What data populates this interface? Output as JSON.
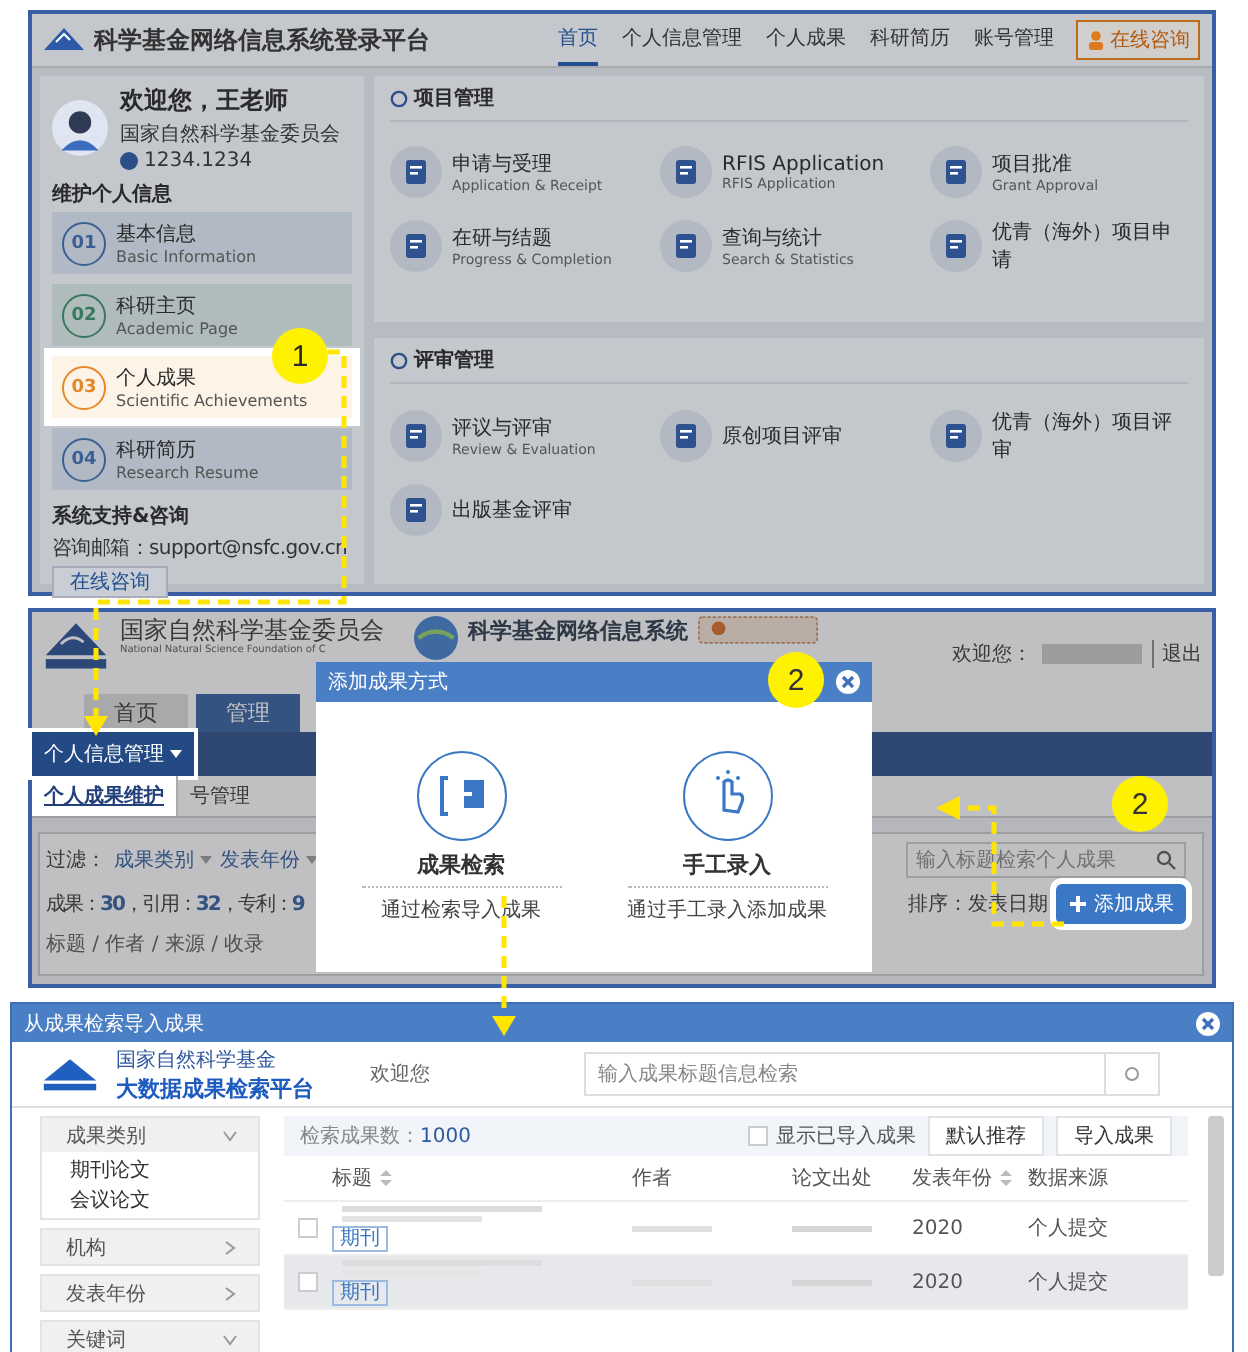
{
  "portal": {
    "title": "科学基金网络信息系统登录平台",
    "nav": [
      {
        "label": "首页",
        "selected": true
      },
      {
        "label": "个人信息管理",
        "selected": false
      },
      {
        "label": "个人成果",
        "selected": false
      },
      {
        "label": "科研简历",
        "selected": false
      },
      {
        "label": "账号管理",
        "selected": false
      }
    ],
    "consult_button": "在线咨询",
    "user": {
      "greeting": "欢迎您，王老师",
      "org": "国家自然科学基金委员会",
      "id": "1234.1234"
    },
    "section_label": "维护个人信息",
    "info_items": [
      {
        "number": "01",
        "title": "基本信息",
        "subtitle": "Basic Information",
        "color": "#3b5f95",
        "selected": false
      },
      {
        "number": "02",
        "title": "科研主页",
        "subtitle": "Academic Page",
        "color": "#357a5c",
        "selected": false
      },
      {
        "number": "03",
        "title": "个人成果",
        "subtitle": "Scientific Achievements",
        "color": "#e3892b",
        "selected": true
      },
      {
        "number": "04",
        "title": "科研简历",
        "subtitle": "Research Resume",
        "color": "#3b5f95",
        "selected": false
      }
    ],
    "support": {
      "title": "系统支持&咨询",
      "email": "咨询邮箱：support@nsfc.gov.cn",
      "button": "在线咨询"
    },
    "groups": [
      {
        "title": "项目管理",
        "items": [
          {
            "title": "申请与受理",
            "subtitle": "Application & Receipt"
          },
          {
            "title": "RFIS Application",
            "subtitle": "RFIS Application"
          },
          {
            "title": "项目批准",
            "subtitle": "Grant Approval"
          },
          {
            "title": "在研与结题",
            "subtitle": "Progress & Completion"
          },
          {
            "title": "查询与统计",
            "subtitle": "Search & Statistics"
          },
          {
            "title": "优青（海外）项目申请"
          }
        ]
      },
      {
        "title": "评审管理",
        "items": [
          {
            "title": "评议与评审",
            "subtitle": "Review & Evaluation"
          },
          {
            "title": "原创项目评审"
          },
          {
            "title": "优青（海外）项目评审"
          },
          {
            "title": "出版基金评审"
          }
        ]
      }
    ],
    "callout": "1"
  },
  "manage": {
    "org_name": "国家自然科学基金委员会",
    "org_name_en": "National Natural Science Foundation of C",
    "system_name": "科学基金网络信息系统",
    "welcome": "欢迎您：",
    "logout": "退出",
    "tabs": [
      {
        "label": "首页",
        "selected": false
      },
      {
        "label": "管理",
        "selected": true
      }
    ],
    "dropdown": "个人信息管理",
    "submenu": [
      {
        "label": "个人成果维护",
        "selected": true
      },
      {
        "label": "号管理",
        "selected": false
      }
    ],
    "filter_label": "过滤：",
    "filters": [
      "成果类别",
      "发表年份"
    ],
    "stats": "成果：**30**，引用：**32**，专利：**9**",
    "columns_line": "标题 / 作者 / 来源 / 收录",
    "search_placeholder": "输入标题检索个人成果",
    "sort": "排序：发表日期",
    "add_button": "添加成果",
    "modal": {
      "title": "添加成果方式",
      "options": [
        {
          "title": "成果检索",
          "description": "通过检索导入成果",
          "kind": "import"
        },
        {
          "title": "手工录入",
          "description": "通过手工录入添加成果",
          "kind": "manual"
        }
      ]
    },
    "callouts": [
      "2",
      "2"
    ]
  },
  "import_dialog": {
    "title": "从成果检索导入成果",
    "logo_top": "国家自然科学基金",
    "logo_name": "大数据成果检索平台",
    "welcome": "欢迎您",
    "search_placeholder": "输入成果标题信息检索",
    "filters": [
      {
        "label": "成果类别",
        "expanded": true,
        "options": [
          "期刊论文",
          "会议论文"
        ]
      },
      {
        "label": "机构",
        "expanded": false
      },
      {
        "label": "发表年份",
        "expanded": false
      },
      {
        "label": "关键词",
        "expanded": true
      }
    ],
    "count": "检索成果数：**1000**",
    "show_imported": {
      "label": "显示已导入成果",
      "checked": false
    },
    "buttons": [
      "默认推荐",
      "导入成果"
    ],
    "columns": [
      {
        "label": "标题",
        "sortable": true
      },
      {
        "label": "作者",
        "sortable": false
      },
      {
        "label": "论文出处",
        "sortable": false
      },
      {
        "label": "发表年份",
        "sortable": true
      },
      {
        "label": "数据来源",
        "sortable": false
      }
    ],
    "rows": [
      {
        "tag": "期刊",
        "year": "2020",
        "source": "个人提交",
        "checked": false,
        "selected": false
      },
      {
        "tag": "期刊",
        "year": "2020",
        "source": "个人提交",
        "checked": false,
        "selected": true
      }
    ]
  }
}
